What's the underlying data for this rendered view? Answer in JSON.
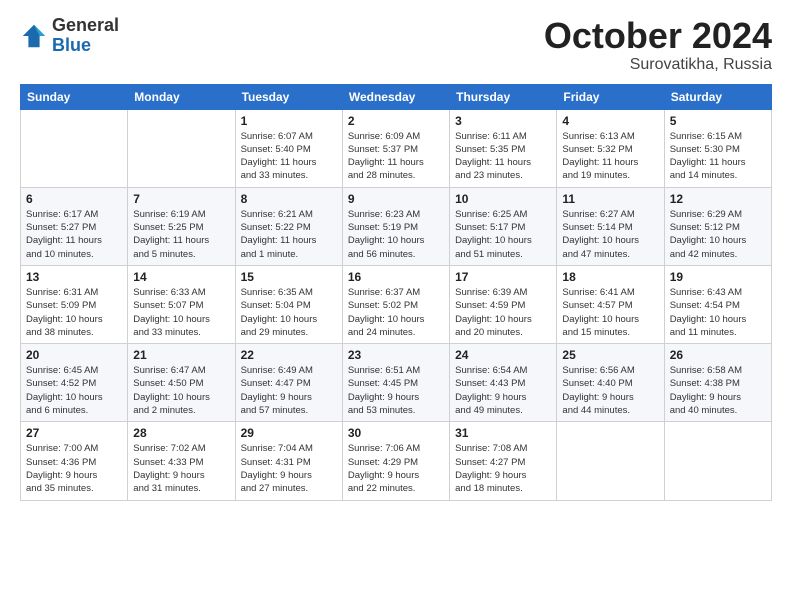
{
  "logo": {
    "general": "General",
    "blue": "Blue"
  },
  "header": {
    "month": "October 2024",
    "location": "Surovatikha, Russia"
  },
  "weekdays": [
    "Sunday",
    "Monday",
    "Tuesday",
    "Wednesday",
    "Thursday",
    "Friday",
    "Saturday"
  ],
  "weeks": [
    [
      {
        "day": "",
        "info": ""
      },
      {
        "day": "",
        "info": ""
      },
      {
        "day": "1",
        "info": "Sunrise: 6:07 AM\nSunset: 5:40 PM\nDaylight: 11 hours\nand 33 minutes."
      },
      {
        "day": "2",
        "info": "Sunrise: 6:09 AM\nSunset: 5:37 PM\nDaylight: 11 hours\nand 28 minutes."
      },
      {
        "day": "3",
        "info": "Sunrise: 6:11 AM\nSunset: 5:35 PM\nDaylight: 11 hours\nand 23 minutes."
      },
      {
        "day": "4",
        "info": "Sunrise: 6:13 AM\nSunset: 5:32 PM\nDaylight: 11 hours\nand 19 minutes."
      },
      {
        "day": "5",
        "info": "Sunrise: 6:15 AM\nSunset: 5:30 PM\nDaylight: 11 hours\nand 14 minutes."
      }
    ],
    [
      {
        "day": "6",
        "info": "Sunrise: 6:17 AM\nSunset: 5:27 PM\nDaylight: 11 hours\nand 10 minutes."
      },
      {
        "day": "7",
        "info": "Sunrise: 6:19 AM\nSunset: 5:25 PM\nDaylight: 11 hours\nand 5 minutes."
      },
      {
        "day": "8",
        "info": "Sunrise: 6:21 AM\nSunset: 5:22 PM\nDaylight: 11 hours\nand 1 minute."
      },
      {
        "day": "9",
        "info": "Sunrise: 6:23 AM\nSunset: 5:19 PM\nDaylight: 10 hours\nand 56 minutes."
      },
      {
        "day": "10",
        "info": "Sunrise: 6:25 AM\nSunset: 5:17 PM\nDaylight: 10 hours\nand 51 minutes."
      },
      {
        "day": "11",
        "info": "Sunrise: 6:27 AM\nSunset: 5:14 PM\nDaylight: 10 hours\nand 47 minutes."
      },
      {
        "day": "12",
        "info": "Sunrise: 6:29 AM\nSunset: 5:12 PM\nDaylight: 10 hours\nand 42 minutes."
      }
    ],
    [
      {
        "day": "13",
        "info": "Sunrise: 6:31 AM\nSunset: 5:09 PM\nDaylight: 10 hours\nand 38 minutes."
      },
      {
        "day": "14",
        "info": "Sunrise: 6:33 AM\nSunset: 5:07 PM\nDaylight: 10 hours\nand 33 minutes."
      },
      {
        "day": "15",
        "info": "Sunrise: 6:35 AM\nSunset: 5:04 PM\nDaylight: 10 hours\nand 29 minutes."
      },
      {
        "day": "16",
        "info": "Sunrise: 6:37 AM\nSunset: 5:02 PM\nDaylight: 10 hours\nand 24 minutes."
      },
      {
        "day": "17",
        "info": "Sunrise: 6:39 AM\nSunset: 4:59 PM\nDaylight: 10 hours\nand 20 minutes."
      },
      {
        "day": "18",
        "info": "Sunrise: 6:41 AM\nSunset: 4:57 PM\nDaylight: 10 hours\nand 15 minutes."
      },
      {
        "day": "19",
        "info": "Sunrise: 6:43 AM\nSunset: 4:54 PM\nDaylight: 10 hours\nand 11 minutes."
      }
    ],
    [
      {
        "day": "20",
        "info": "Sunrise: 6:45 AM\nSunset: 4:52 PM\nDaylight: 10 hours\nand 6 minutes."
      },
      {
        "day": "21",
        "info": "Sunrise: 6:47 AM\nSunset: 4:50 PM\nDaylight: 10 hours\nand 2 minutes."
      },
      {
        "day": "22",
        "info": "Sunrise: 6:49 AM\nSunset: 4:47 PM\nDaylight: 9 hours\nand 57 minutes."
      },
      {
        "day": "23",
        "info": "Sunrise: 6:51 AM\nSunset: 4:45 PM\nDaylight: 9 hours\nand 53 minutes."
      },
      {
        "day": "24",
        "info": "Sunrise: 6:54 AM\nSunset: 4:43 PM\nDaylight: 9 hours\nand 49 minutes."
      },
      {
        "day": "25",
        "info": "Sunrise: 6:56 AM\nSunset: 4:40 PM\nDaylight: 9 hours\nand 44 minutes."
      },
      {
        "day": "26",
        "info": "Sunrise: 6:58 AM\nSunset: 4:38 PM\nDaylight: 9 hours\nand 40 minutes."
      }
    ],
    [
      {
        "day": "27",
        "info": "Sunrise: 7:00 AM\nSunset: 4:36 PM\nDaylight: 9 hours\nand 35 minutes."
      },
      {
        "day": "28",
        "info": "Sunrise: 7:02 AM\nSunset: 4:33 PM\nDaylight: 9 hours\nand 31 minutes."
      },
      {
        "day": "29",
        "info": "Sunrise: 7:04 AM\nSunset: 4:31 PM\nDaylight: 9 hours\nand 27 minutes."
      },
      {
        "day": "30",
        "info": "Sunrise: 7:06 AM\nSunset: 4:29 PM\nDaylight: 9 hours\nand 22 minutes."
      },
      {
        "day": "31",
        "info": "Sunrise: 7:08 AM\nSunset: 4:27 PM\nDaylight: 9 hours\nand 18 minutes."
      },
      {
        "day": "",
        "info": ""
      },
      {
        "day": "",
        "info": ""
      }
    ]
  ]
}
